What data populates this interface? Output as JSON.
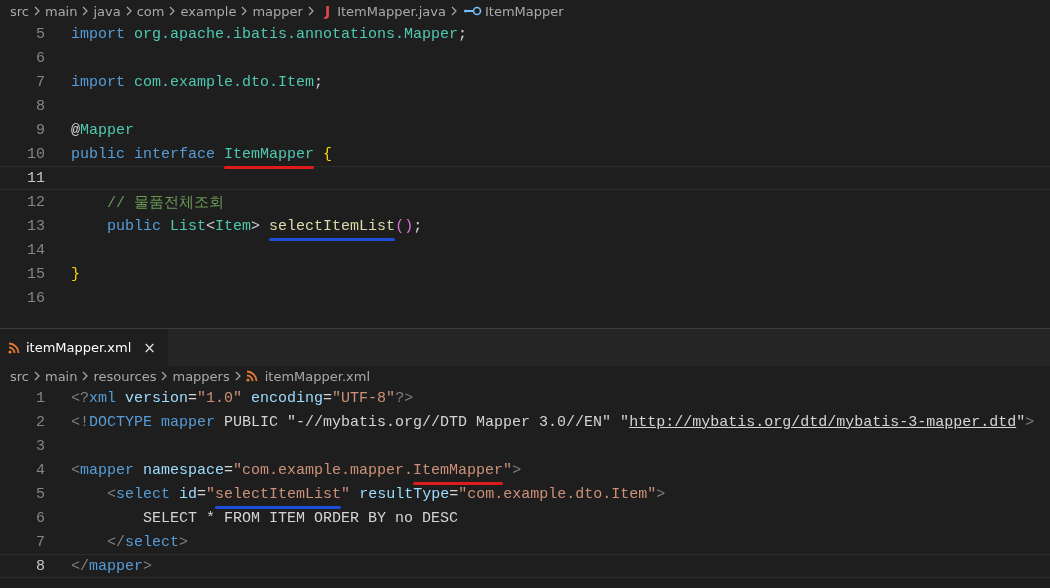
{
  "java_editor": {
    "breadcrumb": [
      {
        "kind": "folder",
        "text": "src"
      },
      {
        "kind": "folder",
        "text": "main"
      },
      {
        "kind": "folder",
        "text": "java"
      },
      {
        "kind": "folder",
        "text": "com"
      },
      {
        "kind": "folder",
        "text": "example"
      },
      {
        "kind": "folder",
        "text": "mapper"
      },
      {
        "kind": "java_file",
        "icon": "J",
        "text": "ItemMapper.java"
      },
      {
        "kind": "symbol",
        "text": "ItemMapper"
      }
    ],
    "lines": [
      {
        "number": "5",
        "current": false,
        "tokens": [
          {
            "kind": "keyword",
            "text": "import "
          },
          {
            "kind": "type",
            "text": "org.apache.ibatis.annotations.Mapper"
          },
          {
            "kind": "plain",
            "text": ";"
          }
        ]
      },
      {
        "number": "6",
        "current": false
      },
      {
        "number": "7",
        "current": false,
        "tokens": [
          {
            "kind": "keyword",
            "text": "import "
          },
          {
            "kind": "type",
            "text": "com.example.dto.Item"
          },
          {
            "kind": "plain",
            "text": ";"
          }
        ]
      },
      {
        "number": "8",
        "current": false
      },
      {
        "number": "9",
        "current": false,
        "tokens": [
          {
            "kind": "plain",
            "text": "@"
          },
          {
            "kind": "type",
            "text": "Mapper"
          }
        ]
      },
      {
        "number": "10",
        "current": false,
        "tokens": [
          {
            "kind": "keyword",
            "text": "public interface "
          },
          {
            "kind": "type",
            "text": "ItemMapper",
            "color": "#e01b1b"
          },
          {
            "kind": "brace",
            "text": " {"
          }
        ]
      },
      {
        "number": "11",
        "current": true
      },
      {
        "number": "12",
        "current": false,
        "tokens": [
          {
            "kind": "comment",
            "text": "    // 물품전체조회"
          }
        ]
      },
      {
        "number": "13",
        "current": false,
        "tokens": [
          {
            "kind": "keyword",
            "text": "    public "
          },
          {
            "kind": "type",
            "text": "List"
          },
          {
            "kind": "plain",
            "text": "<"
          },
          {
            "kind": "type",
            "text": "Item"
          },
          {
            "kind": "plain",
            "text": "> "
          },
          {
            "kind": "function",
            "text": "selectItemList",
            "color": "#1f4fd8"
          },
          {
            "kind": "paren",
            "text": "()"
          },
          {
            "kind": "plain",
            "text": ";"
          }
        ]
      },
      {
        "number": "14",
        "current": false
      },
      {
        "number": "15",
        "current": false,
        "tokens": [
          {
            "kind": "brace",
            "text": "}"
          }
        ]
      },
      {
        "number": "16",
        "current": false
      }
    ]
  },
  "xml_editor": {
    "tab": {
      "label": "itemMapper.xml",
      "close": "×",
      "selected": true
    },
    "breadcrumb": [
      {
        "kind": "folder",
        "text": "src"
      },
      {
        "kind": "folder",
        "text": "main"
      },
      {
        "kind": "folder",
        "text": "resources"
      },
      {
        "kind": "folder",
        "text": "mappers"
      },
      {
        "kind": "xml_file",
        "text": "itemMapper.xml"
      }
    ],
    "lines": [
      {
        "number": "1",
        "current": false,
        "tokens": [
          {
            "kind": "punct",
            "text": "<?"
          },
          {
            "kind": "keyword",
            "text": "xml"
          },
          {
            "kind": "attr",
            "text": " version"
          },
          {
            "kind": "plain",
            "text": "="
          },
          {
            "kind": "string",
            "text": "\"1.0\""
          },
          {
            "kind": "attr",
            "text": " encoding"
          },
          {
            "kind": "plain",
            "text": "="
          },
          {
            "kind": "string",
            "text": "\"UTF-8\""
          },
          {
            "kind": "punct",
            "text": "?>"
          }
        ]
      },
      {
        "number": "2",
        "current": false,
        "tokens": [
          {
            "kind": "punct",
            "text": "<!"
          },
          {
            "kind": "keyword",
            "text": "DOCTYPE mapper"
          },
          {
            "kind": "plain",
            "text": " PUBLIC \"-//mybatis.org//DTD Mapper 3.0//EN\" \""
          },
          {
            "kind": "link",
            "text": "http://mybatis.org/dtd/mybatis-3-mapper.dtd"
          },
          {
            "kind": "plain",
            "text": "\""
          },
          {
            "kind": "punct",
            "text": ">"
          }
        ]
      },
      {
        "number": "3",
        "current": false
      },
      {
        "number": "4",
        "current": false,
        "tokens": [
          {
            "kind": "punct",
            "text": "<"
          },
          {
            "kind": "keyword",
            "text": "mapper"
          },
          {
            "kind": "attr",
            "text": " namespace"
          },
          {
            "kind": "plain",
            "text": "="
          },
          {
            "kind": "string",
            "text": "\"com.example.mapper."
          },
          {
            "kind": "string",
            "text": "ItemMapper",
            "color": "#e01b1b"
          },
          {
            "kind": "string",
            "text": "\""
          },
          {
            "kind": "punct",
            "text": ">"
          }
        ]
      },
      {
        "number": "5",
        "current": false,
        "tokens": [
          {
            "kind": "punct",
            "text": "    <"
          },
          {
            "kind": "keyword",
            "text": "select"
          },
          {
            "kind": "attr",
            "text": " id"
          },
          {
            "kind": "plain",
            "text": "="
          },
          {
            "kind": "string",
            "text": "\""
          },
          {
            "kind": "string",
            "text": "selectItemList",
            "color": "#1f4fd8"
          },
          {
            "kind": "string",
            "text": "\""
          },
          {
            "kind": "attr",
            "text": " resultType"
          },
          {
            "kind": "plain",
            "text": "="
          },
          {
            "kind": "string",
            "text": "\"com.example.dto.Item\""
          },
          {
            "kind": "punct",
            "text": ">"
          }
        ]
      },
      {
        "number": "6",
        "current": false,
        "tokens": [
          {
            "kind": "plain",
            "text": "        SELECT * FROM ITEM ORDER BY no DESC"
          }
        ]
      },
      {
        "number": "7",
        "current": false,
        "tokens": [
          {
            "kind": "punct",
            "text": "    </"
          },
          {
            "kind": "keyword",
            "text": "select"
          },
          {
            "kind": "punct",
            "text": ">"
          }
        ]
      },
      {
        "number": "8",
        "current": true,
        "tokens": [
          {
            "kind": "punct",
            "text": "</"
          },
          {
            "kind": "keyword",
            "text": "mapper"
          },
          {
            "kind": "punct",
            "text": ">"
          }
        ]
      }
    ]
  }
}
